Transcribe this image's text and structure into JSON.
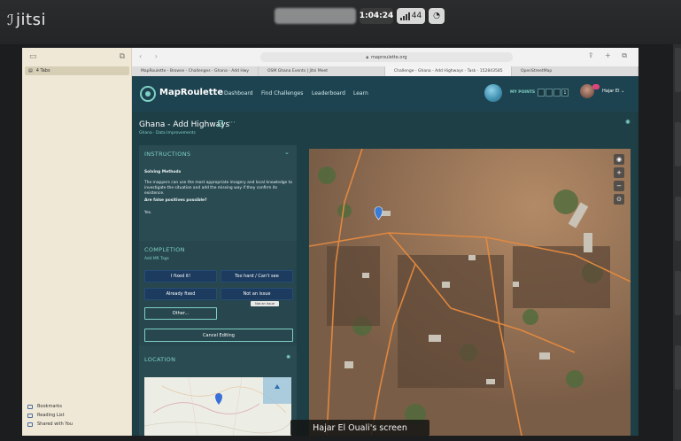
{
  "jitsi": {
    "logo": "jitsi",
    "timer": "1:04:24",
    "participants": "44"
  },
  "sidebar": {
    "tabs_label": "4 Tabs",
    "footer": [
      "Bookmarks",
      "Reading List",
      "Shared with You"
    ]
  },
  "browser": {
    "url": "maproulette.org",
    "tabs": [
      "MapRoulette - Browse - Challenges - Ghana - Add Hwy",
      "OSM Ghana Events | Jitsi Meet",
      "Challenge - Ghana - Add Highways - Task - 152843585",
      "OpenStreetMap"
    ]
  },
  "maproulette": {
    "logo": "MapRoulette",
    "nav": [
      "Dashboard",
      "Find Challenges",
      "Leaderboard",
      "Learn"
    ],
    "my_points": "MY POINTS",
    "points_digits": [
      "",
      "",
      "",
      "1"
    ],
    "user": "Hajar El",
    "challenge_title": "Ghana - Add Highways",
    "challenge_sub": "Ghana · Data Improvements",
    "instructions": {
      "title": "INSTRUCTIONS",
      "heading": "Solving Methods",
      "body": "The mappers can use the most appropriate imagery and local knowledge to investigate the situation and add the missing way if they confirm its existence.",
      "question": "Are false positives possible?",
      "answer": "Yes."
    },
    "completion": {
      "title": "COMPLETION",
      "tags": "Add MR Tags",
      "buttons": [
        "I fixed it!",
        "Too hard / Can't see",
        "Already fixed",
        "Not an issue"
      ],
      "other": "Other...",
      "cancel": "Cancel Editing",
      "tooltip": "Not an issue"
    },
    "location": {
      "title": "LOCATION"
    }
  },
  "caption": "Hajar El Ouali's screen",
  "colors": {
    "accent": "#7fd1c4",
    "nav_bg": "#1e4350",
    "panel_bg": "#2a4b52",
    "button_bg": "#1c3b5e"
  }
}
